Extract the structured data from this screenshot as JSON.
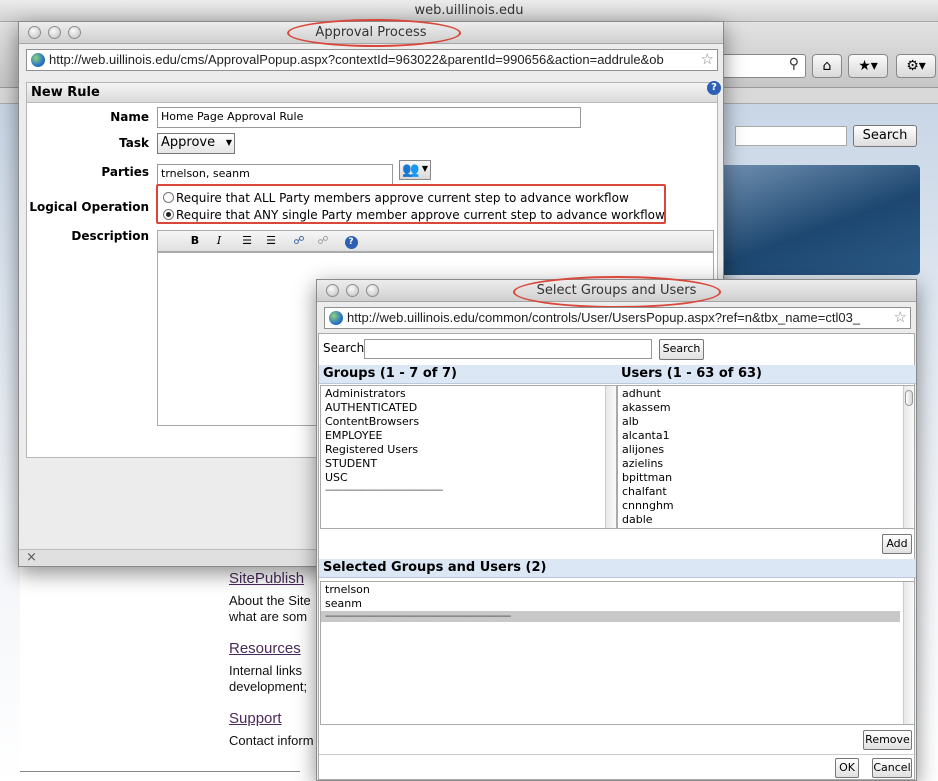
{
  "browser": {
    "title": "web.uillinois.edu",
    "search_button": "Search"
  },
  "page_links": [
    {
      "title": "SitePublish",
      "text1": "About the Site",
      "text2": "what are som"
    },
    {
      "title": "Resources",
      "text1": "Internal links",
      "text2": "development;"
    },
    {
      "title": "Support",
      "text1": "Contact inform",
      "text2": ""
    }
  ],
  "approval": {
    "window_title": "Approval Process",
    "url": "http://web.uillinois.edu/cms/ApprovalPopup.aspx?contextId=963022&parentId=990656&action=addrule&ob",
    "panel_title": "New Rule",
    "help_icon": "?",
    "name_label": "Name",
    "name_value": "Home Page Approval Rule",
    "task_label": "Task",
    "task_value": "Approve",
    "parties_label": "Parties",
    "parties_value": "trnelson, seanm",
    "logic_label": "Logical Operation",
    "logic_options": [
      "Require that ALL Party members approve current step to advance workflow",
      "Require that ANY single Party member approve current step to advance workflow"
    ],
    "logic_selected_index": 1,
    "description_label": "Description",
    "editor_bold": "B",
    "editor_italic": "I",
    "close_glyph": "×"
  },
  "select_dialog": {
    "window_title": "Select Groups and Users",
    "url": "http://web.uillinois.edu/common/controls/User/UsersPopup.aspx?ref=n&tbx_name=ctl03_",
    "search_label": "Search",
    "search_button": "Search",
    "groups_header": "Groups (1 - 7 of 7)",
    "groups": [
      "Administrators",
      "AUTHENTICATED",
      "ContentBrowsers",
      "EMPLOYEE",
      "Registered Users",
      "STUDENT",
      "USC"
    ],
    "groups_separator": "---------------------------------------------",
    "users_header": "Users (1 - 63 of 63)",
    "users": [
      "adhunt",
      "akassem",
      "alb",
      "alcanta1",
      "alijones",
      "azielins",
      "bpittman",
      "chalfant",
      "cnnnghm",
      "dable"
    ],
    "add_button": "Add",
    "selected_header": "Selected Groups and Users (2)",
    "selected": [
      "trnelson",
      "seanm"
    ],
    "selected_separator": "-----------------------------------------------------------------------",
    "remove_button": "Remove",
    "ok_button": "OK",
    "cancel_button": "Cancel"
  }
}
